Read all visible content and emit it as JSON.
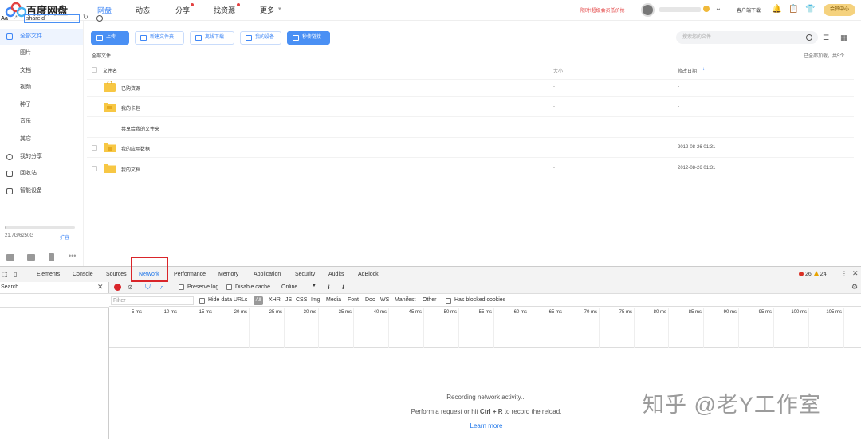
{
  "nav": {
    "brand": "百度网盘",
    "links": [
      "网盘",
      "动态",
      "分享",
      "找资源",
      "更多"
    ],
    "promo": "限时!超级会员低价抢",
    "client_download": "客户端下载",
    "member_center": "会员中心"
  },
  "sidebar": {
    "items": [
      "全部文件",
      "图片",
      "文档",
      "视频",
      "种子",
      "音乐",
      "其它",
      "我的分享",
      "回收站",
      "智能设备"
    ],
    "quota": "21.7G/6250G",
    "quota_used_fraction": 0.0035,
    "expand": "扩容"
  },
  "toolbar": {
    "upload": "上传",
    "new_folder": "新建文件夹",
    "offline_download": "离线下载",
    "my_devices": "我的设备",
    "instant_link": "秒传链接",
    "search_placeholder": "搜索您的文件"
  },
  "files": {
    "breadcrumb": "全部文件",
    "loaded": "已全部加载，共5个",
    "headers": {
      "name": "文件名",
      "size": "大小",
      "modified": "修改日期"
    },
    "rows": [
      {
        "name": "已购资源",
        "size": "-",
        "modified": "-"
      },
      {
        "name": "我的卡包",
        "size": "-",
        "modified": "-"
      },
      {
        "name": "共享给我的文件夹",
        "size": "-",
        "modified": "-"
      },
      {
        "name": "我的应用数据",
        "size": "-",
        "modified": "2012-08-26 01:31"
      },
      {
        "name": "我的文档",
        "size": "-",
        "modified": "2012-08-26 01:31"
      }
    ]
  },
  "devtools": {
    "tabs": [
      "Elements",
      "Console",
      "Sources",
      "Network",
      "Performance",
      "Memory",
      "Application",
      "Security",
      "Audits",
      "AdBlock"
    ],
    "active_tab": "Network",
    "errors": "26",
    "warnings": "24",
    "search_title": "Search",
    "case_toggle": "Aa",
    "regex_toggle": ".*",
    "search_query": "shareid",
    "preserve_log": "Preserve log",
    "disable_cache": "Disable cache",
    "throttling": "Online",
    "filter_placeholder": "Filter",
    "hide_data_urls": "Hide data URLs",
    "types": [
      "All",
      "XHR",
      "JS",
      "CSS",
      "Img",
      "Media",
      "Font",
      "Doc",
      "WS",
      "Manifest",
      "Other"
    ],
    "has_blocked_cookies": "Has blocked cookies",
    "ticks": [
      "5 ms",
      "10 ms",
      "15 ms",
      "20 ms",
      "25 ms",
      "30 ms",
      "35 ms",
      "40 ms",
      "45 ms",
      "50 ms",
      "55 ms",
      "60 ms",
      "65 ms",
      "70 ms",
      "75 ms",
      "80 ms",
      "85 ms",
      "90 ms",
      "95 ms",
      "100 ms",
      "105 ms"
    ],
    "recording": "Recording network activity...",
    "hint_pre": "Perform a request or hit ",
    "hint_keys": "Ctrl + R",
    "hint_post": " to record the reload.",
    "learn_more": "Learn more"
  },
  "watermark": "知乎 @老Y工作室",
  "colors": {
    "accent": "#3e86f6",
    "error": "#d9252a",
    "folder": "#f7c744"
  }
}
